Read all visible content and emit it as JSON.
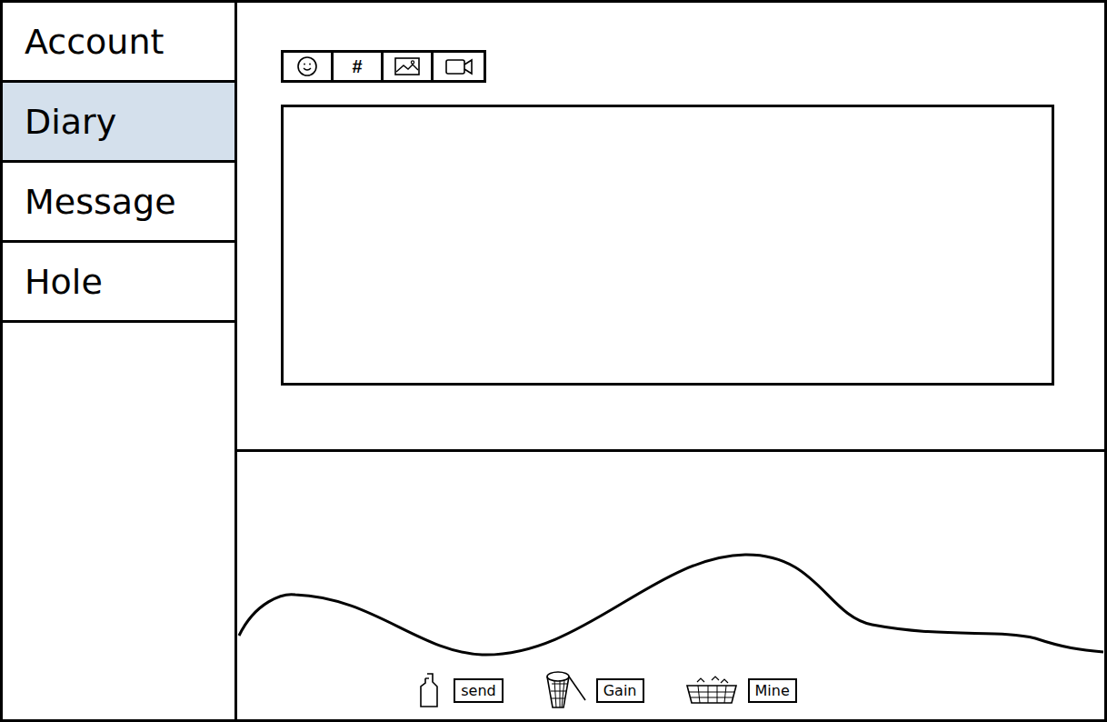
{
  "sidebar": {
    "items": [
      {
        "label": "Account",
        "selected": false
      },
      {
        "label": "Diary",
        "selected": true
      },
      {
        "label": "Message",
        "selected": false
      },
      {
        "label": "Hole",
        "selected": false
      }
    ]
  },
  "toolbar": {
    "tools": [
      {
        "kind": "emoji"
      },
      {
        "kind": "glyph",
        "text": "#"
      },
      {
        "kind": "image"
      },
      {
        "kind": "video"
      }
    ]
  },
  "actions": [
    {
      "kind": "bottle",
      "label": "send"
    },
    {
      "kind": "net",
      "label": "Gain"
    },
    {
      "kind": "basket",
      "label": "Mine"
    }
  ]
}
